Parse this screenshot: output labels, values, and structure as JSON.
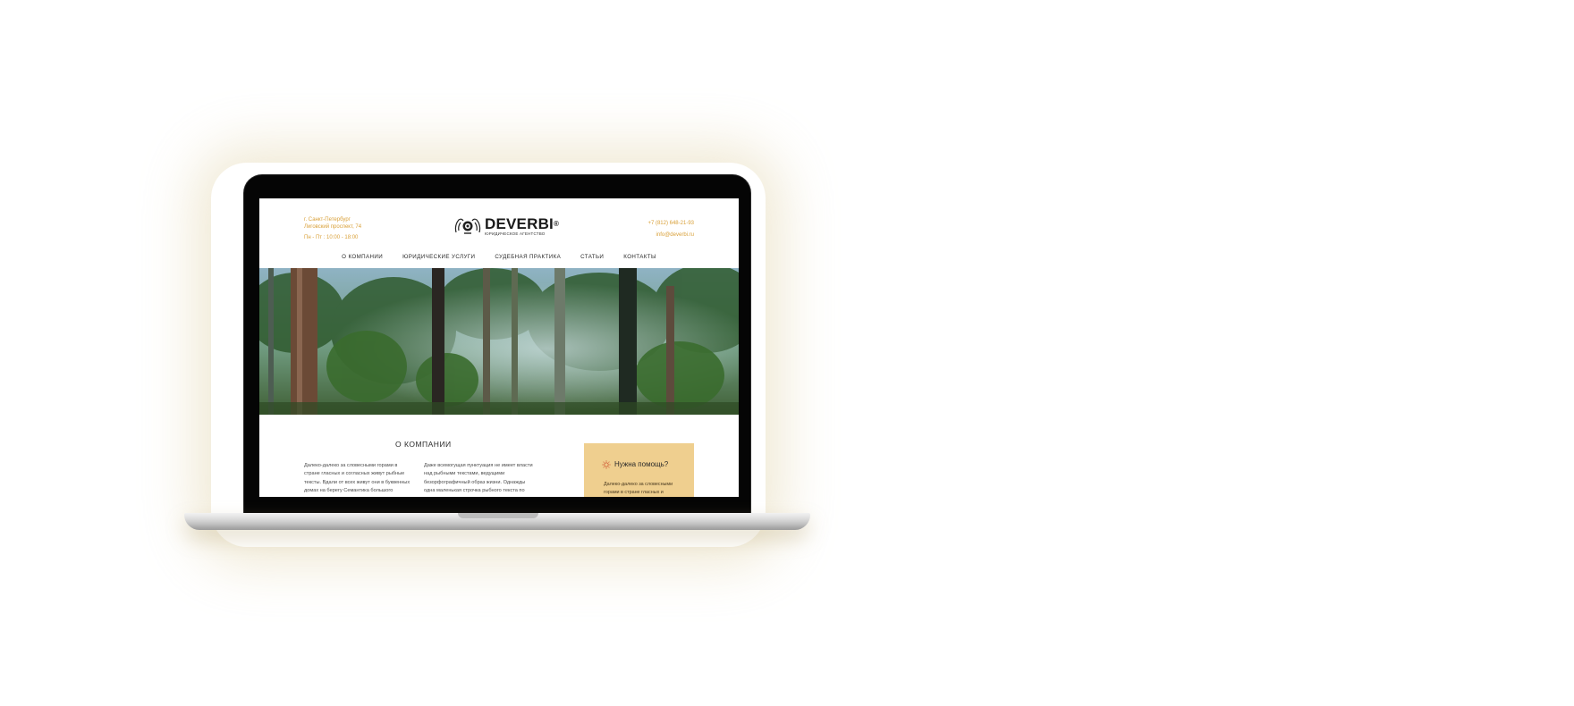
{
  "header": {
    "address_line1": "г. Санкт-Петербург",
    "address_line2": "Лиговский проспект, 74",
    "hours": "Пн - Пт : 10:00 - 18:00",
    "phone": "+7 (812) 648-21-93",
    "email": "info@deverbi.ru"
  },
  "logo": {
    "name": "DEVERBI",
    "registered": "®",
    "subtitle": "ЮРИДИЧЕСКОЕ АГЕНТСТВО"
  },
  "nav": {
    "items": [
      "О КОМПАНИИ",
      "ЮРИДИЧЕСКИЕ УСЛУГИ",
      "СУДЕБНАЯ ПРАКТИКА",
      "СТАТЬИ",
      "КОНТАКТЫ"
    ]
  },
  "about": {
    "title": "О КОМПАНИИ",
    "col1": "Далеко-далеко за словесными горами в стране гласных и согласных живут рыбные тексты. Вдали от всех живут они в буквенных домах на берегу Семантика большого",
    "col2": "Даже всемогущая пунктуация не имеет власти над рыбными текстами, ведущими безорфографичный образ жизни. Однажды одна маленькая строчка рыбного текста по"
  },
  "help": {
    "title": "Нужна помощь?",
    "text": "Далеко-далеко за словесными горами в стране гласных и"
  },
  "colors": {
    "accent": "#d9a13a",
    "help_box": "#efcf8f"
  },
  "icons": {
    "help": "sun-icon",
    "logo": "lion-emblem-icon"
  }
}
